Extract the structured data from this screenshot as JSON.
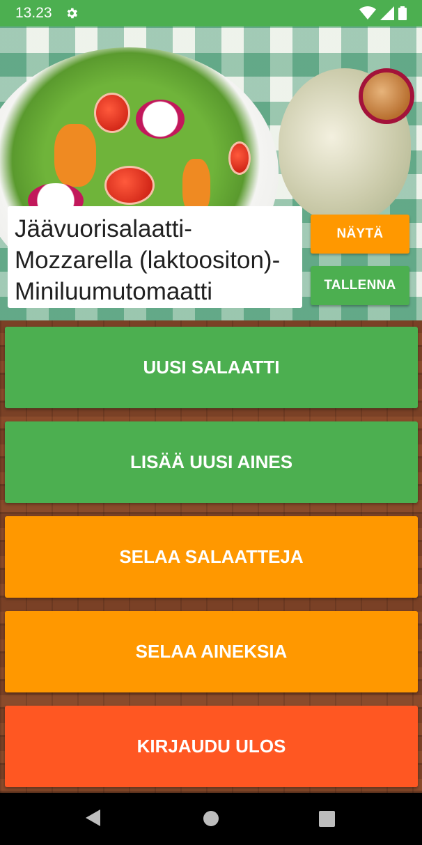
{
  "status_bar": {
    "time": "13.23",
    "icons": [
      "settings-gear-icon",
      "wifi-icon",
      "cell-signal-icon",
      "battery-icon"
    ]
  },
  "salad": {
    "ingredients_text": "Jäävuorisalaatti-Mozzarella (laktoositon)-Miniluumutomaatti"
  },
  "actions": {
    "show_label": "NÄYTÄ",
    "save_label": "TALLENNA"
  },
  "menu": {
    "new_salad": "UUSI SALAATTI",
    "add_ingredient": "LISÄÄ UUSI AINES",
    "browse_salads": "SELAA SALAATTEJA",
    "browse_ingredients": "SELAA AINEKSIA",
    "logout": "KIRJAUDU ULOS"
  },
  "colors": {
    "green": "#4caf50",
    "orange": "#ff9800",
    "deep_orange": "#ff5722"
  },
  "nav_bar": {
    "icons": [
      "back-icon",
      "home-icon",
      "recents-icon"
    ]
  }
}
